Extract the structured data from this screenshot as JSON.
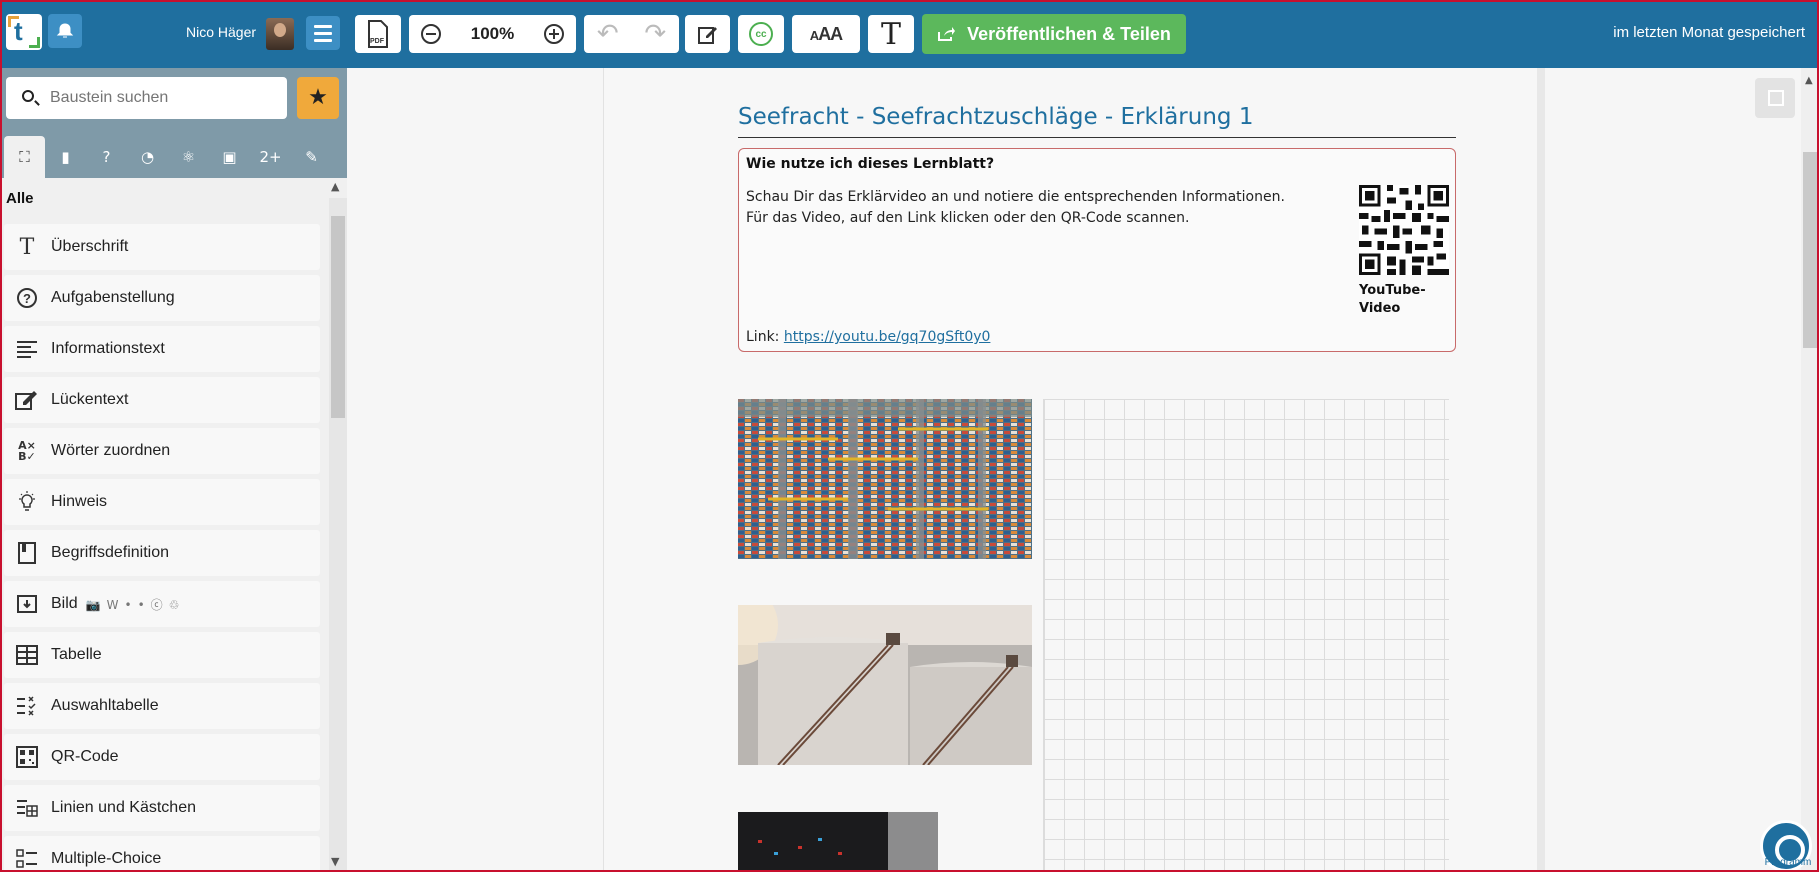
{
  "header": {
    "user_name": "Nico Häger",
    "pdf_label": "PDF",
    "zoom": "100%",
    "cc_label": "cc",
    "font_size_label_small": "A",
    "font_size_label_big": "AA",
    "text_tool_label": "T",
    "publish_label": "Veröffentlichen & Teilen",
    "saved_status": "im letzten Monat gespeichert"
  },
  "sidebar": {
    "search_placeholder": "Baustein suchen",
    "category": "Alle",
    "items": [
      {
        "label": "Überschrift",
        "icon": "heading-icon"
      },
      {
        "label": "Aufgabenstellung",
        "icon": "question-circle-icon"
      },
      {
        "label": "Informationstext",
        "icon": "paragraph-lines-icon"
      },
      {
        "label": "Lückentext",
        "icon": "edit-box-icon"
      },
      {
        "label": "Wörter zuordnen",
        "icon": "match-words-icon"
      },
      {
        "label": "Hinweis",
        "icon": "lightbulb-icon"
      },
      {
        "label": "Begriffsdefinition",
        "icon": "book-icon"
      },
      {
        "label": "Bild",
        "icon": "image-download-icon"
      },
      {
        "label": "Tabelle",
        "icon": "table-icon"
      },
      {
        "label": "Auswahltabelle",
        "icon": "checklist-icon"
      },
      {
        "label": "QR-Code",
        "icon": "qr-code-icon"
      },
      {
        "label": "Linien und Kästchen",
        "icon": "lines-grid-icon"
      },
      {
        "label": "Multiple-Choice",
        "icon": "multiple-choice-icon"
      }
    ]
  },
  "document": {
    "title": "Seefracht - Seefrachtzuschläge - Erklärung 1",
    "info_heading": "Wie nutze ich dieses Lernblatt?",
    "info_text": "Schau Dir das Erklärvideo an und notiere die entsprechenden Informationen. Für das Video, auf den Link klicken oder den QR-Code scannen.",
    "qr_caption": "YouTube-Video",
    "link_label": "Link:",
    "link_url": "https://youtu.be/gq70gSft0y0"
  },
  "help": {
    "label": "Programm"
  },
  "colors": {
    "topbar": "#1f6f9f",
    "publish": "#5cb85c",
    "star": "#f0a93b",
    "frame": "#c8102e"
  }
}
